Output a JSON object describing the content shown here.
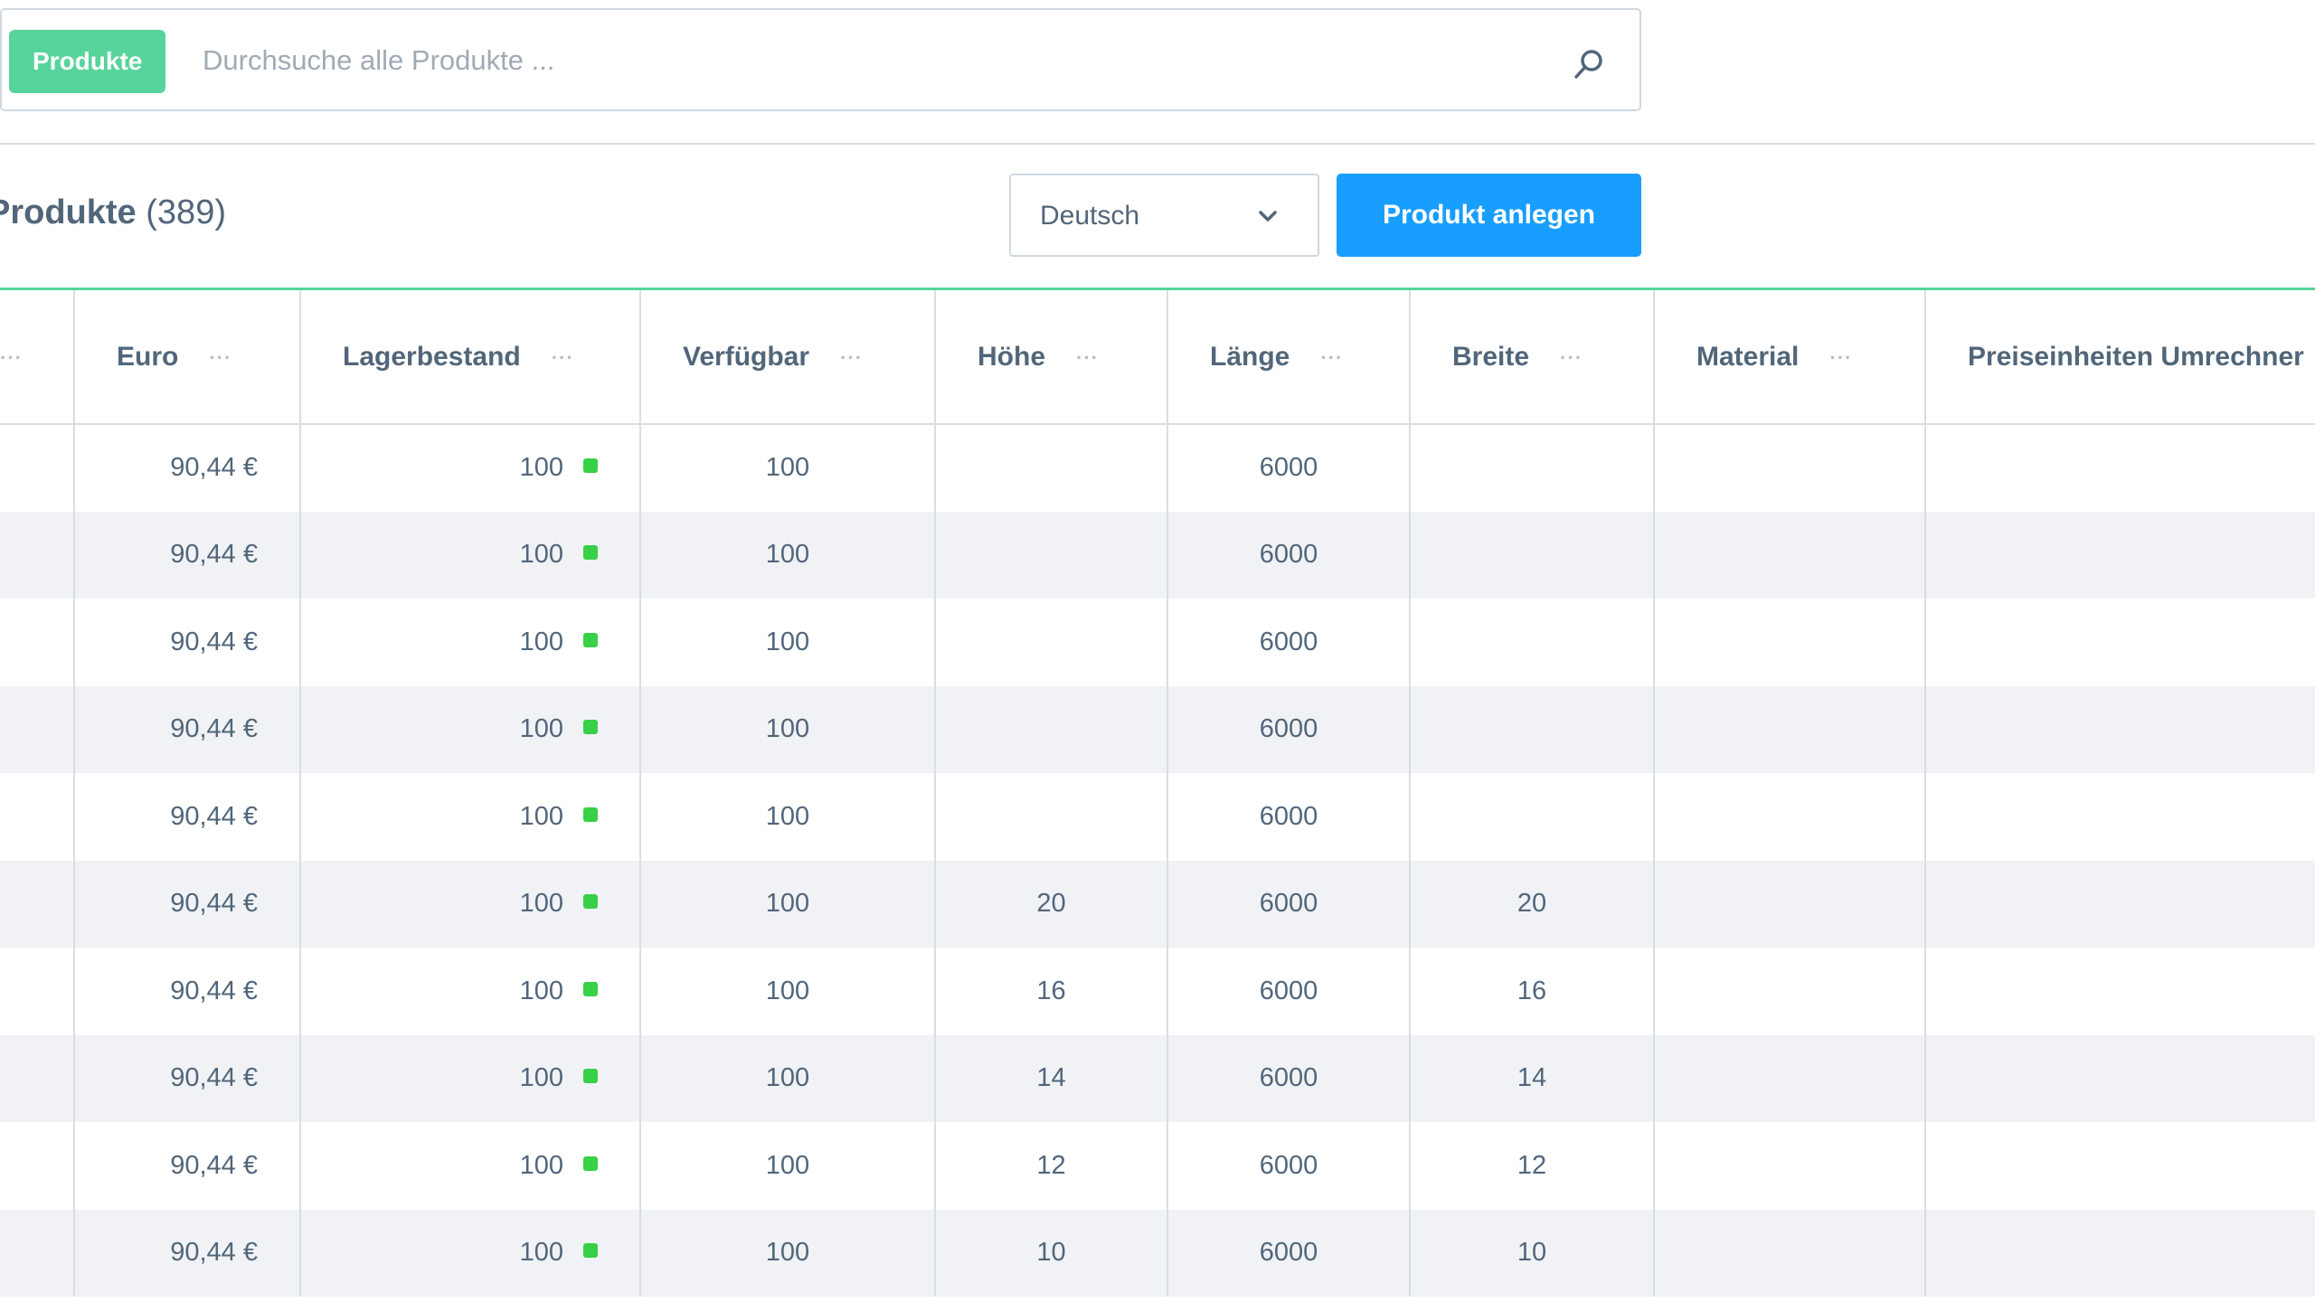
{
  "search": {
    "badge": "Produkte",
    "placeholder": "Durchsuche alle Produkte ..."
  },
  "header": {
    "title": "Produkte",
    "count": "(389)",
    "language": "Deutsch",
    "create_label": "Produkt anlegen"
  },
  "table": {
    "columns": {
      "first": "",
      "euro": "Euro",
      "stock": "Lagerbestand",
      "available": "Verfügbar",
      "height": "Höhe",
      "length": "Länge",
      "width": "Breite",
      "material": "Material",
      "units": "Preiseinheiten Umrechner"
    },
    "column_menu_label": "···",
    "rows": [
      {
        "euro": "90,44 €",
        "stock": "100",
        "available": "100",
        "height": "",
        "length": "6000",
        "width": "",
        "material": "",
        "units": ""
      },
      {
        "euro": "90,44 €",
        "stock": "100",
        "available": "100",
        "height": "",
        "length": "6000",
        "width": "",
        "material": "",
        "units": ""
      },
      {
        "euro": "90,44 €",
        "stock": "100",
        "available": "100",
        "height": "",
        "length": "6000",
        "width": "",
        "material": "",
        "units": ""
      },
      {
        "euro": "90,44 €",
        "stock": "100",
        "available": "100",
        "height": "",
        "length": "6000",
        "width": "",
        "material": "",
        "units": ""
      },
      {
        "euro": "90,44 €",
        "stock": "100",
        "available": "100",
        "height": "",
        "length": "6000",
        "width": "",
        "material": "",
        "units": ""
      },
      {
        "euro": "90,44 €",
        "stock": "100",
        "available": "100",
        "height": "20",
        "length": "6000",
        "width": "20",
        "material": "",
        "units": ""
      },
      {
        "euro": "90,44 €",
        "stock": "100",
        "available": "100",
        "height": "16",
        "length": "6000",
        "width": "16",
        "material": "",
        "units": ""
      },
      {
        "euro": "90,44 €",
        "stock": "100",
        "available": "100",
        "height": "14",
        "length": "6000",
        "width": "14",
        "material": "",
        "units": ""
      },
      {
        "euro": "90,44 €",
        "stock": "100",
        "available": "100",
        "height": "12",
        "length": "6000",
        "width": "12",
        "material": "",
        "units": ""
      },
      {
        "euro": "90,44 €",
        "stock": "100",
        "available": "100",
        "height": "10",
        "length": "6000",
        "width": "10",
        "material": "",
        "units": ""
      }
    ]
  },
  "colors": {
    "accent_green": "#57d49b",
    "primary_blue": "#189eff",
    "stock_ok": "#37d046"
  }
}
